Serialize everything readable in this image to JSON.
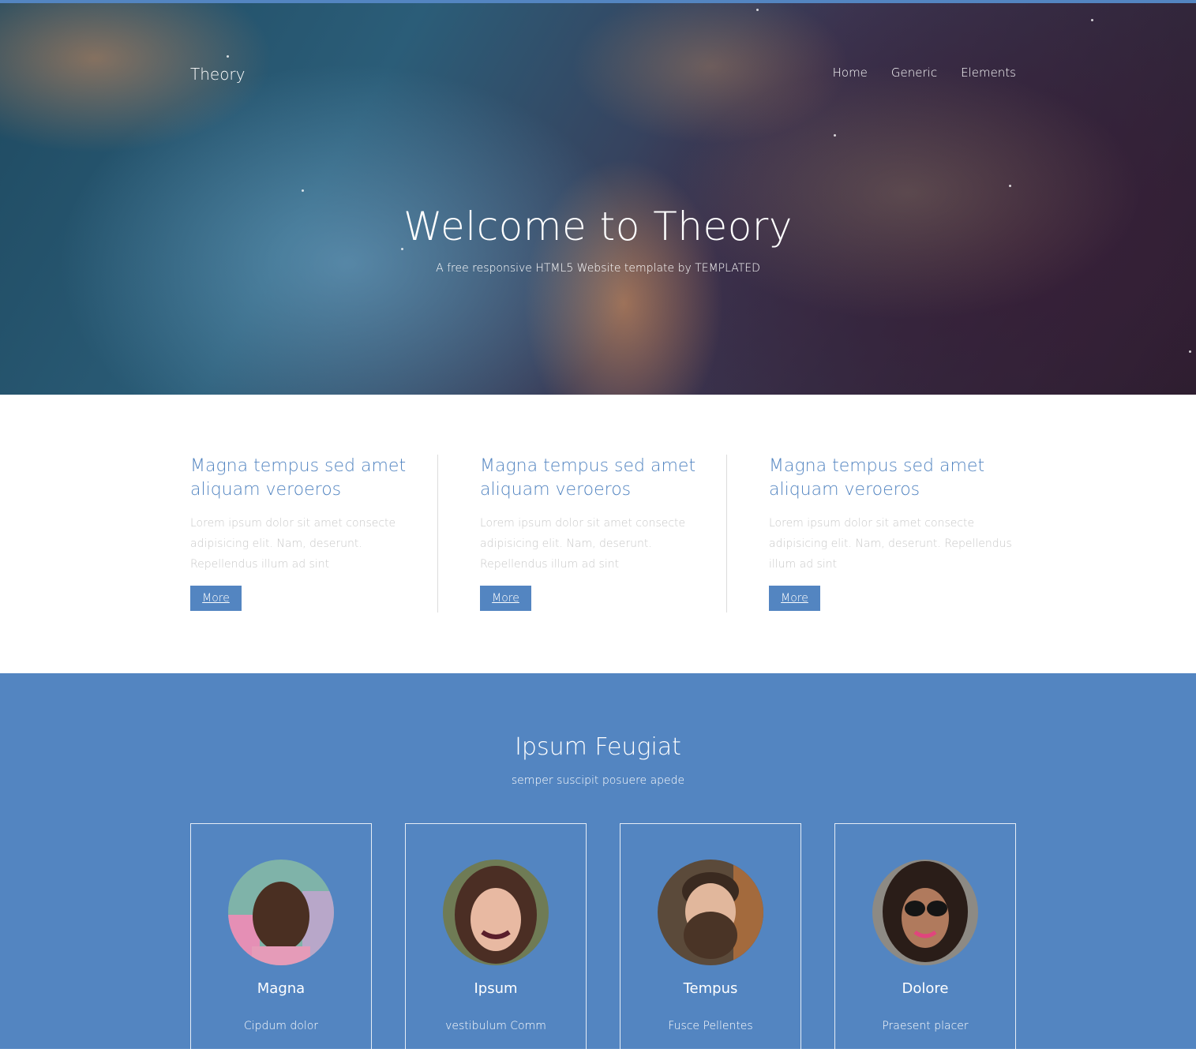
{
  "header": {
    "logo": "Theory",
    "nav": [
      "Home",
      "Generic",
      "Elements"
    ]
  },
  "hero": {
    "title": "Welcome to Theory",
    "subtitle": "A free responsive HTML5 Website template by TEMPLATED"
  },
  "features": [
    {
      "title": "Magna tempus sed amet aliquam veroeros",
      "text": "Lorem ipsum dolor sit amet consecte adipisicing elit. Nam, deserunt. Repellendus illum ad sint",
      "button": "More"
    },
    {
      "title": "Magna tempus sed amet aliquam veroeros",
      "text": "Lorem ipsum dolor sit amet consecte adipisicing elit. Nam, deserunt. Repellendus illum ad sint",
      "button": "More"
    },
    {
      "title": "Magna tempus sed amet aliquam veroeros",
      "text": "Lorem ipsum dolor sit amet consecte adipisicing elit. Nam, deserunt. Repellendus illum ad sint",
      "button": "More"
    }
  ],
  "team": {
    "title": "Ipsum Feugiat",
    "subtitle": "semper suscipit posuere apede",
    "members": [
      {
        "name": "Magna",
        "role": "Cipdum dolor"
      },
      {
        "name": "Ipsum",
        "role": "vestibulum Comm"
      },
      {
        "name": "Tempus",
        "role": "Fusce Pellentes"
      },
      {
        "name": "Dolore",
        "role": "Praesent placer"
      }
    ]
  },
  "colors": {
    "accent": "#5385c1",
    "heading_blue": "#5385c1",
    "muted_text": "#c9c9c9",
    "white": "#ffffff"
  }
}
